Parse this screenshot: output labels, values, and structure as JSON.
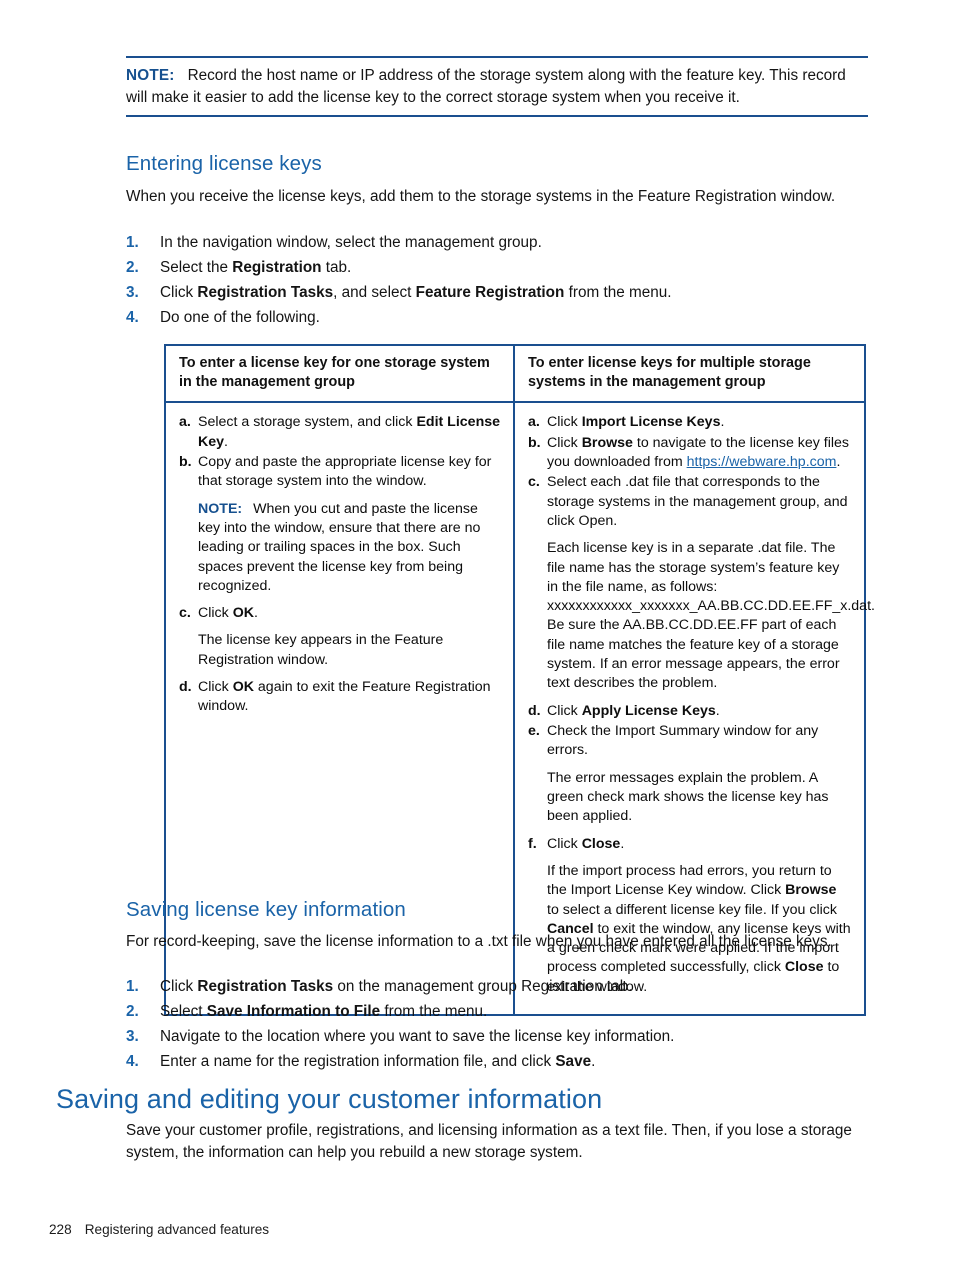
{
  "note_top": {
    "label": "NOTE:",
    "text": "Record the host name or IP address of the storage system along with the feature key. This record will make it easier to add the license key to the correct storage system when you receive it."
  },
  "section_entering": {
    "heading": "Entering license keys",
    "intro": "When you receive the license keys, add them to the storage systems in the Feature Registration window.",
    "steps": [
      {
        "num": "1.",
        "parts": [
          {
            "t": "In the navigation window, select the management group."
          }
        ]
      },
      {
        "num": "2.",
        "parts": [
          {
            "t": "Select the "
          },
          {
            "t": "Registration",
            "b": true
          },
          {
            "t": " tab."
          }
        ]
      },
      {
        "num": "3.",
        "parts": [
          {
            "t": "Click "
          },
          {
            "t": "Registration Tasks",
            "b": true
          },
          {
            "t": ", and select "
          },
          {
            "t": "Feature Registration",
            "b": true
          },
          {
            "t": " from the menu."
          }
        ]
      },
      {
        "num": "4.",
        "parts": [
          {
            "t": "Do one of the following."
          }
        ]
      }
    ]
  },
  "table": {
    "headers": [
      "To enter a license key for one storage system in the management group",
      "To enter license keys for multiple storage systems in the management group"
    ],
    "left_items": [
      {
        "mk": "a.",
        "parts": [
          {
            "t": "Select a storage system, and click "
          },
          {
            "t": "Edit License Key",
            "b": true
          },
          {
            "t": "."
          }
        ]
      },
      {
        "mk": "b.",
        "parts": [
          {
            "t": "Copy and paste the appropriate license key for that storage system into the window."
          }
        ]
      },
      {
        "mk": "",
        "note_label": "NOTE:",
        "parts": [
          {
            "t": "When you cut and paste the license key into the window, ensure that there are no leading or trailing spaces in the box. Such spaces prevent the license key from being recognized."
          }
        ]
      },
      {
        "mk": "c.",
        "parts": [
          {
            "t": "Click "
          },
          {
            "t": "OK",
            "b": true
          },
          {
            "t": "."
          }
        ]
      },
      {
        "mk": "",
        "parts": [
          {
            "t": "The license key appears in the Feature Registration window."
          }
        ]
      },
      {
        "mk": "d.",
        "parts": [
          {
            "t": "Click "
          },
          {
            "t": "OK",
            "b": true
          },
          {
            "t": " again to exit the Feature Registration window."
          }
        ]
      }
    ],
    "right_items": [
      {
        "mk": "a.",
        "parts": [
          {
            "t": "Click "
          },
          {
            "t": "Import License Keys",
            "b": true
          },
          {
            "t": "."
          }
        ]
      },
      {
        "mk": "b.",
        "parts": [
          {
            "t": "Click "
          },
          {
            "t": "Browse",
            "b": true
          },
          {
            "t": " to navigate to the license key files you downloaded from "
          },
          {
            "t": "https://webware.hp.com",
            "link": true
          },
          {
            "t": "."
          }
        ]
      },
      {
        "mk": "c.",
        "parts": [
          {
            "t": "Select each .dat file that corresponds to the storage systems in the management group, and click Open."
          }
        ]
      },
      {
        "mk": "",
        "parts": [
          {
            "t": "Each license key is in a separate .dat file. The file name has the storage system’s feature key in the file name, as follows: xxxxxxxxxxxx_xxxxxxx_AA.BB.CC.DD.EE.FF_x.dat. Be sure the AA.BB.CC.DD.EE.FF part of each file name matches the feature key of a storage system. If an error message appears, the error text describes the problem."
          }
        ]
      },
      {
        "mk": "d.",
        "parts": [
          {
            "t": "Click "
          },
          {
            "t": "Apply License Keys",
            "b": true
          },
          {
            "t": "."
          }
        ]
      },
      {
        "mk": "e.",
        "parts": [
          {
            "t": "Check the Import Summary window for any errors."
          }
        ]
      },
      {
        "mk": "",
        "parts": [
          {
            "t": "The error messages explain the problem. A green check mark shows the license key has been applied."
          }
        ]
      },
      {
        "mk": "f.",
        "parts": [
          {
            "t": "Click "
          },
          {
            "t": "Close",
            "b": true
          },
          {
            "t": "."
          }
        ]
      },
      {
        "mk": "",
        "parts": [
          {
            "t": "If the import process had errors, you return to the Import License Key window. Click "
          },
          {
            "t": "Browse",
            "b": true
          },
          {
            "t": " to select a different license key file. If you click "
          },
          {
            "t": "Cancel",
            "b": true
          },
          {
            "t": " to exit the window, any license keys with a green check mark were applied. If the import process completed successfully, click "
          },
          {
            "t": "Close",
            "b": true
          },
          {
            "t": " to exit the window."
          }
        ]
      }
    ]
  },
  "section_saving_keys": {
    "heading": "Saving license key information",
    "intro": "For record-keeping, save the license information to a .txt file when you have entered all the license keys.",
    "steps": [
      {
        "num": "1.",
        "parts": [
          {
            "t": "Click "
          },
          {
            "t": "Registration Tasks",
            "b": true
          },
          {
            "t": " on the management group Registration tab."
          }
        ]
      },
      {
        "num": "2.",
        "parts": [
          {
            "t": "Select "
          },
          {
            "t": "Save Information to File",
            "b": true
          },
          {
            "t": " from the menu."
          }
        ]
      },
      {
        "num": "3.",
        "parts": [
          {
            "t": "Navigate to the location where you want to save the license key information."
          }
        ]
      },
      {
        "num": "4.",
        "parts": [
          {
            "t": "Enter a name for the registration information file, and click "
          },
          {
            "t": "Save",
            "b": true
          },
          {
            "t": "."
          }
        ]
      }
    ]
  },
  "section_customer": {
    "heading": "Saving and editing your customer information",
    "body": "Save your customer profile, registrations, and licensing information as a text file. Then, if you lose a storage system, the information can help you rebuild a new storage system."
  },
  "footer": {
    "page_number": "228",
    "chapter": "Registering advanced features"
  },
  "colors": {
    "heading_blue": "#1a63a8",
    "rule_blue": "#1a4f8f",
    "link_blue": "#1a63a8",
    "body_text": "#141414"
  }
}
